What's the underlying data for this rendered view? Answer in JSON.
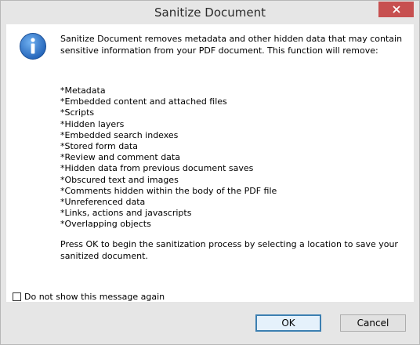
{
  "window": {
    "title": "Sanitize Document",
    "close_icon": "close-icon"
  },
  "message": {
    "icon": "info-icon",
    "intro": "Sanitize Document removes metadata and other hidden data that may contain sensitive information from your PDF document. This function will remove:",
    "items": [
      "*Metadata",
      "*Embedded content and attached files",
      "*Scripts",
      "*Hidden layers",
      "*Embedded search indexes",
      "*Stored form data",
      "*Review and comment data",
      "*Hidden data from previous document saves",
      "*Obscured text and images",
      "*Comments hidden within the body of the PDF file",
      "*Unreferenced data",
      "*Links, actions and javascripts",
      "*Overlapping objects"
    ],
    "outro": "Press OK to begin the sanitization process by selecting a location to save your sanitized document."
  },
  "footer": {
    "checkbox_label": "Do not show this message again",
    "checkbox_checked": false,
    "ok_label": "OK",
    "cancel_label": "Cancel"
  },
  "colors": {
    "close_button": "#c75050",
    "info_icon": "#2a6fc9",
    "ok_border": "#3c7fb1"
  }
}
